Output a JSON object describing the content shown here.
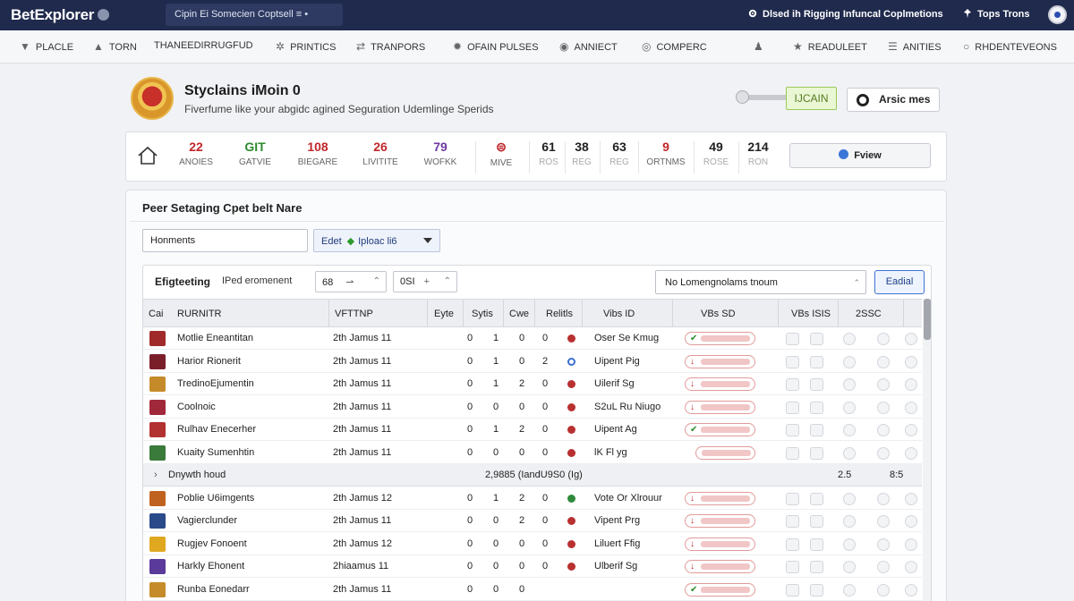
{
  "topbar": {
    "logo": "BetExplorer",
    "search_text": "Cipin Ei Somecien Coptsell ≡ •",
    "right_link_1": "Dlsed ih Rigging Infuncal Coplmetions",
    "right_link_2": "Tops Trons"
  },
  "nav": {
    "items": [
      {
        "icon": "filter-icon",
        "label": "PLACLE"
      },
      {
        "icon": "arrow-up-icon",
        "label": "TORN"
      },
      {
        "icon": "",
        "label": "THANEEDIRRUGFUD"
      },
      {
        "icon": "gear-icon",
        "label": "PRINTICS"
      },
      {
        "icon": "swap-icon",
        "label": "TRANPORS"
      },
      {
        "icon": "cog-icon",
        "label": "OFAIN PULSES"
      },
      {
        "icon": "info-icon",
        "label": "ANNIECT"
      },
      {
        "icon": "target-icon",
        "label": "COMPERC"
      },
      {
        "icon": "user-icon",
        "label": ""
      },
      {
        "icon": "star-icon",
        "label": "READULEET"
      },
      {
        "icon": "sliders-icon",
        "label": "ANITIES"
      },
      {
        "icon": "circle-icon",
        "label": "RHDENTEVEONS"
      }
    ]
  },
  "header": {
    "title": "Styclains iMoin 0",
    "subtitle": "Fiverfume like your abgidc agined Seguration Udemlinge Sperids",
    "green_label": "IJCAIN",
    "action_button": "Arsic mes"
  },
  "stats": {
    "items": [
      {
        "value": "22",
        "label": "ANOIES",
        "color": "#c0262a"
      },
      {
        "value": "GIT",
        "label": "GATVIE",
        "color": "#2e8b2e"
      },
      {
        "value": "108",
        "label": "BIEGARE",
        "color": "#c0262a"
      },
      {
        "value": "26",
        "label": "LIVITITE",
        "color": "#c0262a"
      },
      {
        "value": "79",
        "label": "WOFKK",
        "color": "#6c3aa0"
      },
      {
        "value": "⊜",
        "label": "MIVE",
        "color": "#c0262a"
      },
      {
        "value": "61",
        "label": "ROS",
        "color": "#222222"
      },
      {
        "value": "38",
        "label": "REG",
        "color": "#222222"
      },
      {
        "value": "63",
        "label": "REG",
        "color": "#222222"
      },
      {
        "value": "9",
        "label": "ORTNMS",
        "color": "#c0262a"
      },
      {
        "value": "49",
        "label": "ROSE",
        "color": "#222222"
      },
      {
        "value": "214",
        "label": "RON",
        "color": "#222222"
      }
    ],
    "button": "Fview"
  },
  "panel": {
    "title": "Peer Setaging Cpet belt Nare",
    "field1": "Honments",
    "field2_prefix": "Edet",
    "field2_value": "Iploac li6",
    "table_title": "Efigteeting",
    "table_sub": "IPed eromenent",
    "mini1": "68",
    "mini1_icon": "⇀",
    "mini2": "0SI",
    "mini2_icon": "+",
    "select_value": "No Lomengnolams tnoum",
    "edit_button": "Eadial",
    "headers": [
      "Cai",
      "RURNITR",
      "VFTTNP",
      "Eyte",
      "Sytis",
      "Cwe",
      "Relitls",
      "Vibs ID",
      "VBs SD",
      "VBs ISIS",
      "2SSC"
    ],
    "rows": [
      {
        "team": "Motlie Eneantitan",
        "date": "2th Jamus 11",
        "c1": "0",
        "c2": "1",
        "c3": "0",
        "c4": "0",
        "dot": "#b93030",
        "vid": "Oser Se Kmug",
        "pill": "up",
        "icon": "#a02a2a"
      },
      {
        "team": "Harior Rionerit",
        "date": "2th Jamus 11",
        "c1": "0",
        "c2": "1",
        "c3": "0",
        "c4": "2",
        "dot": "ring",
        "vid": "Uipent Pig",
        "pill": "down",
        "icon": "#7a1f2a"
      },
      {
        "team": "TredinoEjumentin",
        "date": "2th Jamus 11",
        "c1": "0",
        "c2": "1",
        "c3": "2",
        "c4": "0",
        "dot": "#b93030",
        "vid": "Uilerif Sg",
        "pill": "down",
        "icon": "#c58b2a"
      },
      {
        "team": "Coolnoic",
        "date": "2th Jamus 11",
        "c1": "0",
        "c2": "0",
        "c3": "0",
        "c4": "0",
        "dot": "#b93030",
        "vid": "S2uL Ru Niugo",
        "pill": "down",
        "icon": "#a0283a"
      },
      {
        "team": "Rulhav Enecerher",
        "date": "2th Jamus 11",
        "c1": "0",
        "c2": "1",
        "c3": "2",
        "c4": "0",
        "dot": "#b93030",
        "vid": "Uipent Ag",
        "pill": "up",
        "icon": "#b23131"
      },
      {
        "team": "Kuaity Sumenhtin",
        "date": "2th Jamus 11",
        "c1": "0",
        "c2": "0",
        "c3": "0",
        "c4": "0",
        "dot": "#b93030",
        "vid": "lK Fl yg",
        "pill": "none",
        "icon": "#3a7a3a"
      }
    ],
    "subtotal": {
      "label": "Dnywth houd",
      "mid": "2,9885 (IandU9S0 (Ig)",
      "v1": "2.5",
      "v2": "8:5"
    },
    "rows2": [
      {
        "team": "Poblie U6imgents",
        "date": "2th Jamus 12",
        "c1": "0",
        "c2": "1",
        "c3": "2",
        "c4": "0",
        "dot": "#2e8a3a",
        "vid": "Vote Or Xlrouur",
        "pill": "down",
        "icon": "#c0621f"
      },
      {
        "team": "Vagierclunder",
        "date": "2th Jamus 11",
        "c1": "0",
        "c2": "0",
        "c3": "2",
        "c4": "0",
        "dot": "#b93030",
        "vid": "Vipent Prg",
        "pill": "down",
        "icon": "#2a4a8a"
      },
      {
        "team": "Rugjev Fonoent",
        "date": "2th Jamus 12",
        "c1": "0",
        "c2": "0",
        "c3": "0",
        "c4": "0",
        "dot": "#b93030",
        "vid": "Liluert Ffig",
        "pill": "down",
        "icon": "#e0a820"
      },
      {
        "team": "Harkly Ehonent",
        "date": "2hiaamus 11",
        "c1": "0",
        "c2": "0",
        "c3": "0",
        "c4": "0",
        "dot": "#b93030",
        "vid": "Ulberif Sg",
        "pill": "down",
        "icon": "#5a3a9a"
      },
      {
        "team": "Runba Eonedarr",
        "date": "2th Jamus 11",
        "c1": "0",
        "c2": "0",
        "c3": "0",
        "c4": "",
        "dot": "",
        "vid": "",
        "pill": "up",
        "icon": "#c58b2a"
      }
    ]
  }
}
